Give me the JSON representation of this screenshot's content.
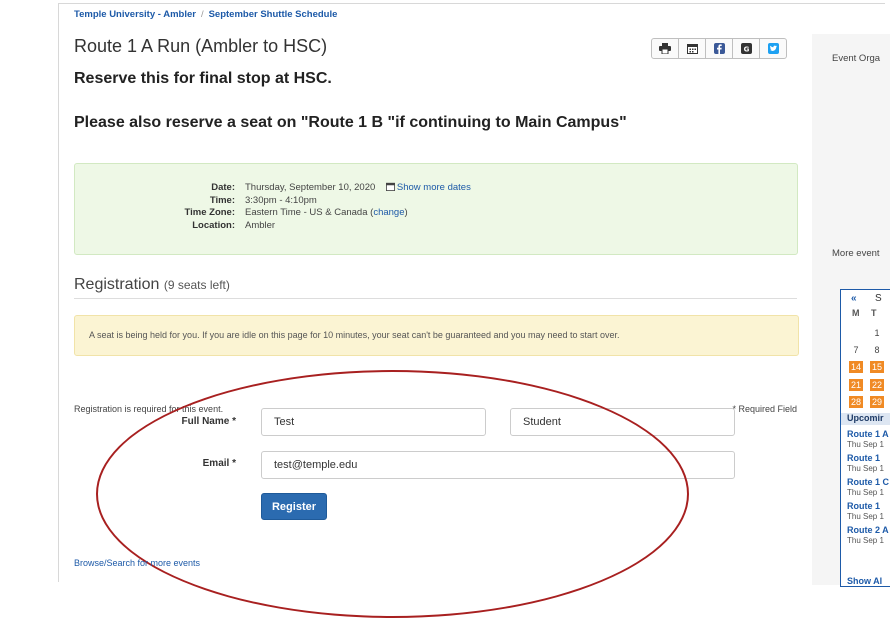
{
  "breadcrumb": {
    "home": "Temple University - Ambler",
    "sep": "/",
    "current": "September Shuttle Schedule"
  },
  "event": {
    "title": "Route 1 A Run (Ambler to HSC)",
    "note1": "Reserve this for final stop at HSC.",
    "note2": "Please also reserve a seat on \"Route 1 B \"if continuing to Main Campus\""
  },
  "toolbar": {
    "icons": [
      "print-icon",
      "calendar-icon",
      "facebook-icon",
      "google-icon",
      "twitter-icon"
    ]
  },
  "info": {
    "date_label": "Date:",
    "date_value": "Thursday, September 10, 2020",
    "show_more_dates": "Show more dates",
    "time_label": "Time:",
    "time_value": "3:30pm - 4:10pm",
    "tz_label": "Time Zone:",
    "tz_value": "Eastern Time - US & Canada",
    "tz_open": "(",
    "tz_change": "change",
    "tz_close": ")",
    "loc_label": "Location:",
    "loc_value": "Ambler"
  },
  "registration": {
    "heading": "Registration",
    "seats": "(9 seats left)",
    "hold_notice": "A seat is being held for you. If you are idle on this page for 10 minutes, your seat can't be guaranteed and you may need to start over.",
    "required_note": "Registration is required for this event.",
    "required_field": "* Required Field",
    "fullname_label": "Full Name *",
    "first_name": "Test",
    "last_name": "Student",
    "email_label": "Email *",
    "email": "test@temple.edu",
    "register_button": "Register"
  },
  "footer": {
    "browse": "Browse/Search for more events"
  },
  "sidebar": {
    "organizer": "Event Orga",
    "more_events": "More event",
    "calendar": {
      "prev": "«",
      "month": "S",
      "dow": [
        "M",
        "T"
      ],
      "days": [
        "1",
        "7",
        "8",
        "14",
        "15",
        "21",
        "22",
        "28",
        "29"
      ],
      "upcoming": "Upcomir",
      "events": [
        {
          "title": "Route 1 A",
          "date": "Thu Sep 1"
        },
        {
          "title": "Route 1",
          "date": "Thu Sep 1"
        },
        {
          "title": "Route 1 C",
          "date": "Thu Sep 1"
        },
        {
          "title": "Route 1",
          "date": "Thu Sep 1"
        },
        {
          "title": "Route 2 A",
          "date": "Thu Sep 1"
        }
      ],
      "show_all": "Show Al"
    }
  },
  "colors": {
    "accent": "#1d5aa8",
    "button": "#2b6bb0",
    "highlight_day": "#f08a24",
    "circle": "#a82020"
  }
}
